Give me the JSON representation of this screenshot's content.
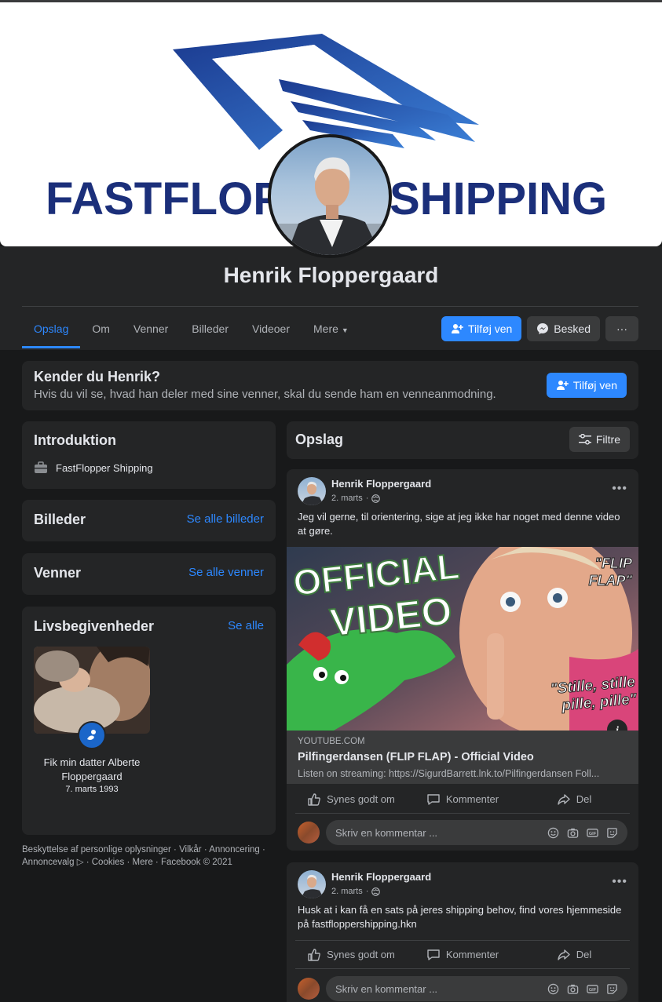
{
  "cover": {
    "brand_left": "FASTFLOP",
    "brand_right": "SHIPPING",
    "brand_color": "#1b2f7a"
  },
  "profile": {
    "name": "Henrik Floppergaard"
  },
  "tabs": [
    {
      "label": "Opslag",
      "active": true
    },
    {
      "label": "Om"
    },
    {
      "label": "Venner"
    },
    {
      "label": "Billeder"
    },
    {
      "label": "Videoer"
    },
    {
      "label": "Mere"
    }
  ],
  "actions": {
    "add_friend": "Tilføj ven",
    "message": "Besked",
    "more": "···"
  },
  "know_card": {
    "title": "Kender du Henrik?",
    "subtitle": "Hvis du vil se, hvad han deler med sine venner, skal du sende ham en venneanmodning.",
    "button": "Tilføj ven"
  },
  "intro": {
    "title": "Introduktion",
    "workplace": "FastFlopper Shipping"
  },
  "photos": {
    "title": "Billeder",
    "link": "Se alle billeder"
  },
  "friends": {
    "title": "Venner",
    "link": "Se alle venner"
  },
  "life_events": {
    "title": "Livsbegivenheder",
    "link": "Se alle",
    "event_caption": "Fik min datter Alberte Floppergaard",
    "event_date": "7. marts 1993"
  },
  "footer": {
    "text": "Beskyttelse af personlige oplysninger · Vilkår · Annoncering · Annoncevalg ▷ · Cookies · Mere · Facebook © 2021"
  },
  "feed": {
    "title": "Opslag",
    "filter": "Filtre"
  },
  "posts": [
    {
      "author": "Henrik Floppergaard",
      "date": "2. marts",
      "text": "Jeg vil gerne, til orientering, sige at jeg ikke har noget med denne video at gøre.",
      "video": {
        "text_official": "OFFICIAL",
        "text_video": "VIDEO",
        "text_flip": "\"FLIP FLAP\"",
        "text_stille": "\"Stille, stille pille, pille\""
      },
      "link": {
        "domain": "YOUTUBE.COM",
        "title": "Pilfingerdansen (FLIP FLAP) - Official Video",
        "desc": "Listen on streaming: https://SigurdBarrett.lnk.to/Pilfingerdansen Foll..."
      }
    },
    {
      "author": "Henrik Floppergaard",
      "date": "2. marts",
      "text": "Husk at i kan få en sats på jeres shipping behov, find vores hjemmeside på fastfloppershipping.hkn"
    }
  ],
  "reactions": {
    "like": "Synes godt om",
    "comment": "Kommenter",
    "share": "Del"
  },
  "comment": {
    "placeholder": "Skriv en kommentar ..."
  },
  "colors": {
    "background": "#18191a",
    "card": "#242526",
    "accent": "#2d88ff",
    "text_primary": "#e4e6eb",
    "text_secondary": "#b0b3b8"
  }
}
